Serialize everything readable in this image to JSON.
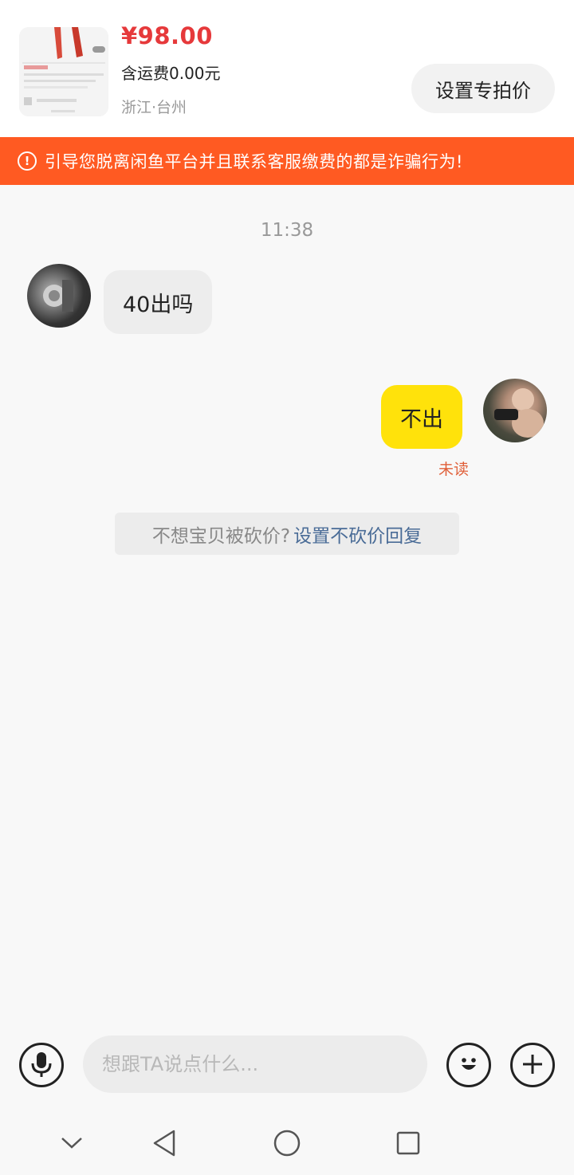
{
  "product": {
    "price": "¥98.00",
    "shipping": "含运费0.00元",
    "location": "浙江·台州",
    "special_price_label": "设置专拍价"
  },
  "warning": {
    "text": "引导您脱离闲鱼平台并且联系客服缴费的都是诈骗行为!",
    "icon": "exclamation-circle-icon",
    "color": "#ff5a22"
  },
  "chat": {
    "timestamp": "11:38",
    "messages": [
      {
        "side": "left",
        "text": "40出吗"
      },
      {
        "side": "right",
        "text": "不出",
        "status": "未读"
      }
    ],
    "tip": {
      "text": "不想宝贝被砍价?",
      "link": "设置不砍价回复"
    }
  },
  "input_bar": {
    "placeholder": "想跟TA说点什么...",
    "voice_icon": "microphone-icon",
    "emoji_icon": "smiley-icon",
    "plus_icon": "plus-icon"
  },
  "nav_bar": {
    "icons": [
      "chevron-down-icon",
      "back-triangle-icon",
      "home-circle-icon",
      "recent-square-icon"
    ]
  },
  "colors": {
    "accent_yellow": "#ffe20b",
    "price_red": "#e6393b",
    "link_blue": "#4a6c97"
  }
}
